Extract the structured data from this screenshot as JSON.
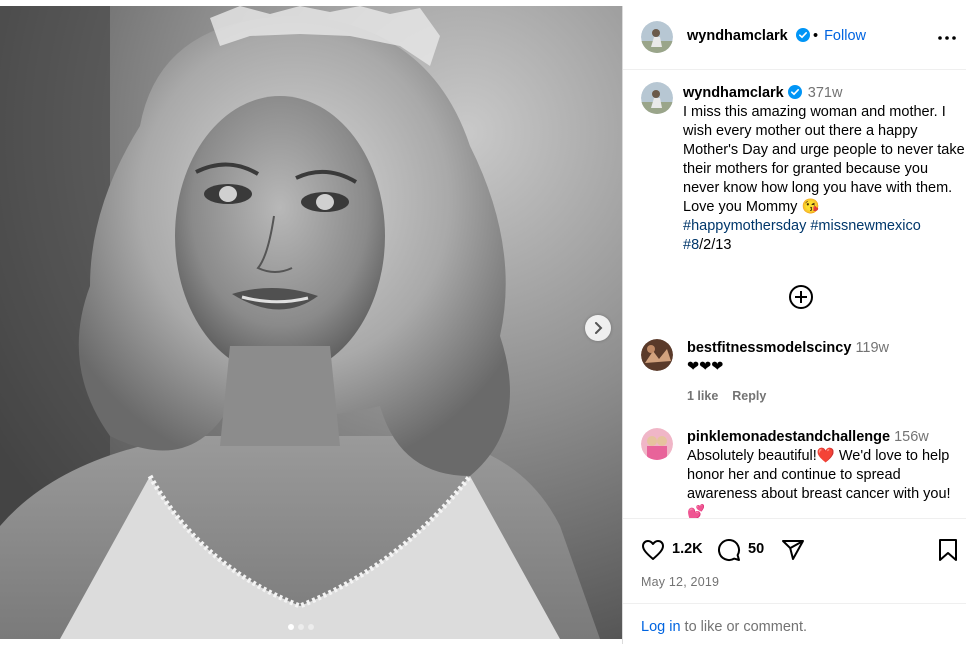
{
  "post": {
    "media": {
      "next_icon": "chevron-right-icon",
      "dot_count": 3,
      "active_dot": 0
    },
    "author": {
      "username": "wyndhamclark",
      "verified": true,
      "follow_separator": "•",
      "follow_label": "Follow",
      "more_icon": "more-horizontal-icon"
    },
    "caption": {
      "username": "wyndhamclark",
      "time": "371w",
      "text": "I miss this amazing woman and mother. I wish every mother out there a happy Mother's Day and urge people to never take their mothers for granted because you never know how long you have with them. Love you Mommy 😘",
      "hashtag1": "#happymothersday",
      "hashtag2": "#missnewmexico",
      "hashtag3": "#8",
      "tail": "/2/13"
    },
    "load_more_icon": "plus-circle-icon",
    "comments": [
      {
        "username": "bestfitnessmodelscincy",
        "time": "119w",
        "text": "❤❤❤",
        "likes": "1 like",
        "reply": "Reply"
      },
      {
        "username": "pinklemonadestandchallenge",
        "time": "156w",
        "text": "Absolutely beautiful!❤️ We'd love to help honor her and continue to spread awareness about breast cancer with you!💕"
      }
    ],
    "actions": {
      "like_count": "1.2K",
      "comment_count": "50",
      "date": "May 12, 2019"
    },
    "login": {
      "link": "Log in",
      "rest": " to like or comment."
    },
    "colors": {
      "link_blue": "#0064e0",
      "hashtag_blue": "#00376b",
      "muted": "#737373",
      "border": "#dbdbdb"
    }
  }
}
